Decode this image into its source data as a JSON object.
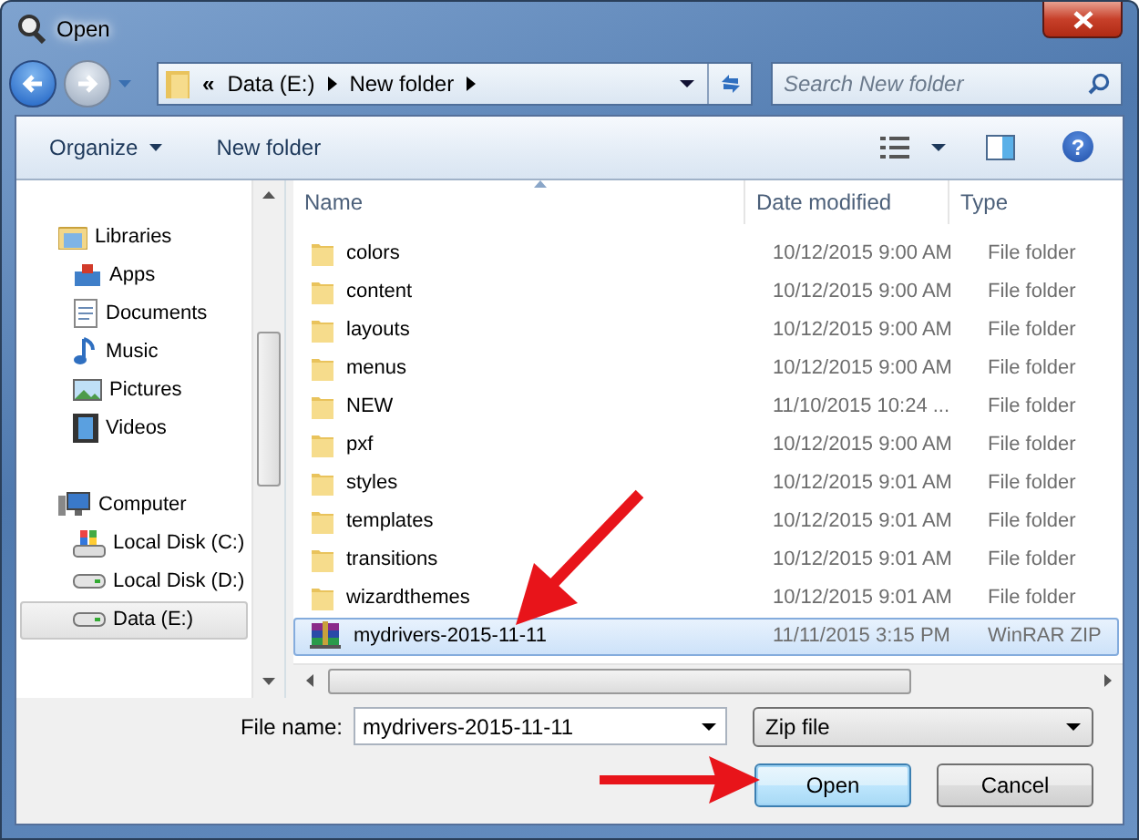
{
  "window": {
    "title": "Open"
  },
  "address_bar": {
    "overflow_mark": "«",
    "crumbs": [
      "Data (E:)",
      "New folder"
    ]
  },
  "search": {
    "placeholder": "Search New folder"
  },
  "toolbar": {
    "buttons": [
      {
        "label": "Organize",
        "kind": "menu"
      },
      {
        "label": "New folder",
        "kind": "plain"
      }
    ],
    "help_mark": "?"
  },
  "sidebar": {
    "groups": [
      {
        "label": "Libraries",
        "kind": "libraries",
        "selected": false,
        "children": [
          {
            "label": "Apps",
            "kind": "apps",
            "selected": false
          },
          {
            "label": "Documents",
            "kind": "documents",
            "selected": false
          },
          {
            "label": "Music",
            "kind": "music",
            "selected": false
          },
          {
            "label": "Pictures",
            "kind": "pictures",
            "selected": false
          },
          {
            "label": "Videos",
            "kind": "videos",
            "selected": false
          }
        ]
      },
      {
        "label": "Computer",
        "kind": "computer",
        "selected": false,
        "children": [
          {
            "label": "Local Disk (C:)",
            "kind": "system-disk",
            "selected": false
          },
          {
            "label": "Local Disk (D:)",
            "kind": "disk",
            "selected": false
          },
          {
            "label": "Data (E:)",
            "kind": "disk",
            "selected": true
          }
        ]
      }
    ]
  },
  "file_list": {
    "columns": [
      "Name",
      "Date modified",
      "Type"
    ],
    "rows": [
      {
        "name": "colors",
        "date": "10/12/2015 9:00 AM",
        "type": "File folder",
        "kind": "folder",
        "selected": false
      },
      {
        "name": "content",
        "date": "10/12/2015 9:00 AM",
        "type": "File folder",
        "kind": "folder",
        "selected": false
      },
      {
        "name": "layouts",
        "date": "10/12/2015 9:00 AM",
        "type": "File folder",
        "kind": "folder",
        "selected": false
      },
      {
        "name": "menus",
        "date": "10/12/2015 9:00 AM",
        "type": "File folder",
        "kind": "folder",
        "selected": false
      },
      {
        "name": "NEW",
        "date": "11/10/2015 10:24 ...",
        "type": "File folder",
        "kind": "folder",
        "selected": false
      },
      {
        "name": "pxf",
        "date": "10/12/2015 9:00 AM",
        "type": "File folder",
        "kind": "folder",
        "selected": false
      },
      {
        "name": "styles",
        "date": "10/12/2015 9:01 AM",
        "type": "File folder",
        "kind": "folder",
        "selected": false
      },
      {
        "name": "templates",
        "date": "10/12/2015 9:01 AM",
        "type": "File folder",
        "kind": "folder",
        "selected": false
      },
      {
        "name": "transitions",
        "date": "10/12/2015 9:01 AM",
        "type": "File folder",
        "kind": "folder",
        "selected": false
      },
      {
        "name": "wizardthemes",
        "date": "10/12/2015 9:01 AM",
        "type": "File folder",
        "kind": "folder",
        "selected": false
      },
      {
        "name": "mydrivers-2015-11-11",
        "date": "11/11/2015 3:15 PM",
        "type": "WinRAR ZIP",
        "kind": "archive",
        "selected": true
      }
    ]
  },
  "file_name": {
    "label": "File name:",
    "value": "mydrivers-2015-11-11"
  },
  "file_type": {
    "value": "Zip file"
  },
  "buttons": [
    {
      "label": "Open",
      "default": true
    },
    {
      "label": "Cancel",
      "default": false
    }
  ]
}
